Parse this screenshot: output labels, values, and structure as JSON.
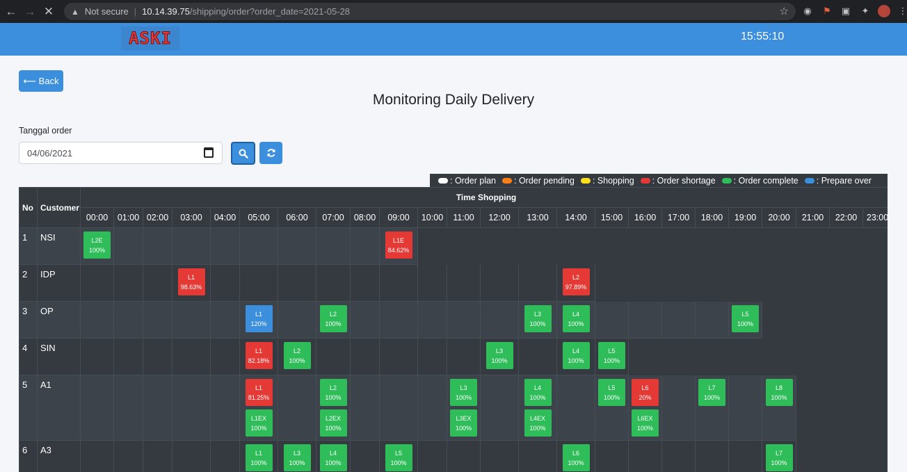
{
  "browser": {
    "security": "Not secure",
    "url_host": "10.14.39.75",
    "url_path": "/shipping/order?order_date=2021-05-28"
  },
  "app": {
    "logo": "ASKI",
    "clock": "15:55:10"
  },
  "page": {
    "back_label": "⟵ Back",
    "title": "Monitoring Daily Delivery",
    "date_label": "Tanggal order",
    "date_value": "04/06/2021"
  },
  "legend": [
    {
      "label": ": Order plan",
      "color": "#ffffff"
    },
    {
      "label": ": Order pending",
      "color": "#fd7e14"
    },
    {
      "label": ": Shopping",
      "color": "#ffe01b"
    },
    {
      "label": ": Order shortage",
      "color": "#e53935"
    },
    {
      "label": ": Order complete",
      "color": "#2ebd59"
    },
    {
      "label": ": Prepare over",
      "color": "#3c8fdc"
    }
  ],
  "colors": {
    "red": "#e53935",
    "green": "#2ebd59",
    "blue": "#3c8fdc"
  },
  "table": {
    "col_no": "No",
    "col_customer": "Customer",
    "col_time": "Time Shopping",
    "hours": [
      "00:00",
      "01:00",
      "02:00",
      "03:00",
      "04:00",
      "05:00",
      "06:00",
      "07:00",
      "08:00",
      "09:00",
      "10:00",
      "11:00",
      "12:00",
      "13:00",
      "14:00",
      "15:00",
      "16:00",
      "17:00",
      "18:00",
      "19:00",
      "20:00",
      "21:00",
      "22:00",
      "23:00"
    ],
    "rows": [
      {
        "no": "1",
        "customer": "NSI",
        "filled_to": 10,
        "items": [
          {
            "h": 0,
            "label": "L2E",
            "pct": "100%",
            "status": "green"
          },
          {
            "h": 9,
            "label": "L1E",
            "pct": "84.62%",
            "status": "red"
          }
        ]
      },
      {
        "no": "2",
        "customer": "IDP",
        "filled_to": 15,
        "items": [
          {
            "h": 3,
            "label": "L1",
            "pct": "98.63%",
            "status": "red"
          },
          {
            "h": 14,
            "label": "L2",
            "pct": "97.89%",
            "status": "red"
          }
        ]
      },
      {
        "no": "3",
        "customer": "OP",
        "filled_to": 20,
        "items": [
          {
            "h": 5,
            "label": "L1",
            "pct": "120%",
            "status": "blue"
          },
          {
            "h": 7,
            "label": "L2",
            "pct": "100%",
            "status": "green"
          },
          {
            "h": 13,
            "label": "L3",
            "pct": "100%",
            "status": "green"
          },
          {
            "h": 14,
            "label": "L4",
            "pct": "100%",
            "status": "green"
          },
          {
            "h": 19,
            "label": "L5",
            "pct": "100%",
            "status": "green"
          }
        ]
      },
      {
        "no": "4",
        "customer": "SIN",
        "filled_to": 16,
        "items": [
          {
            "h": 5,
            "label": "L1",
            "pct": "82.18%",
            "status": "red"
          },
          {
            "h": 6,
            "label": "L2",
            "pct": "100%",
            "status": "green"
          },
          {
            "h": 12,
            "label": "L3",
            "pct": "100%",
            "status": "green"
          },
          {
            "h": 14,
            "label": "L4",
            "pct": "100%",
            "status": "green"
          },
          {
            "h": 15,
            "label": "L5",
            "pct": "100%",
            "status": "green"
          }
        ]
      },
      {
        "no": "5",
        "customer": "A1",
        "filled_to": 21,
        "items": [
          {
            "h": 5,
            "label": "L1",
            "pct": "81.25%",
            "status": "red"
          },
          {
            "h": 5,
            "label": "L1EX",
            "pct": "100%",
            "status": "green"
          },
          {
            "h": 7,
            "label": "L2",
            "pct": "100%",
            "status": "green"
          },
          {
            "h": 7,
            "label": "L2EX",
            "pct": "100%",
            "status": "green"
          },
          {
            "h": 11,
            "label": "L3",
            "pct": "100%",
            "status": "green"
          },
          {
            "h": 11,
            "label": "L3EX",
            "pct": "100%",
            "status": "green"
          },
          {
            "h": 13,
            "label": "L4",
            "pct": "100%",
            "status": "green"
          },
          {
            "h": 13,
            "label": "L4EX",
            "pct": "100%",
            "status": "green"
          },
          {
            "h": 15,
            "label": "L5",
            "pct": "100%",
            "status": "green"
          },
          {
            "h": 16,
            "label": "L6",
            "pct": "20%",
            "status": "red"
          },
          {
            "h": 16,
            "label": "L6EX",
            "pct": "100%",
            "status": "green"
          },
          {
            "h": 18,
            "label": "L7",
            "pct": "100%",
            "status": "green"
          },
          {
            "h": 20,
            "label": "L8",
            "pct": "100%",
            "status": "green"
          }
        ]
      },
      {
        "no": "6",
        "customer": "A3",
        "filled_to": 21,
        "items": [
          {
            "h": 5,
            "label": "L1",
            "pct": "100%",
            "status": "green"
          },
          {
            "h": 6,
            "label": "L3",
            "pct": "100%",
            "status": "green"
          },
          {
            "h": 7,
            "label": "L4",
            "pct": "100%",
            "status": "green"
          },
          {
            "h": 9,
            "label": "L5",
            "pct": "100%",
            "status": "green"
          },
          {
            "h": 14,
            "label": "L6",
            "pct": "100%",
            "status": "green"
          },
          {
            "h": 20,
            "label": "L7",
            "pct": "100%",
            "status": "green"
          }
        ]
      }
    ]
  }
}
